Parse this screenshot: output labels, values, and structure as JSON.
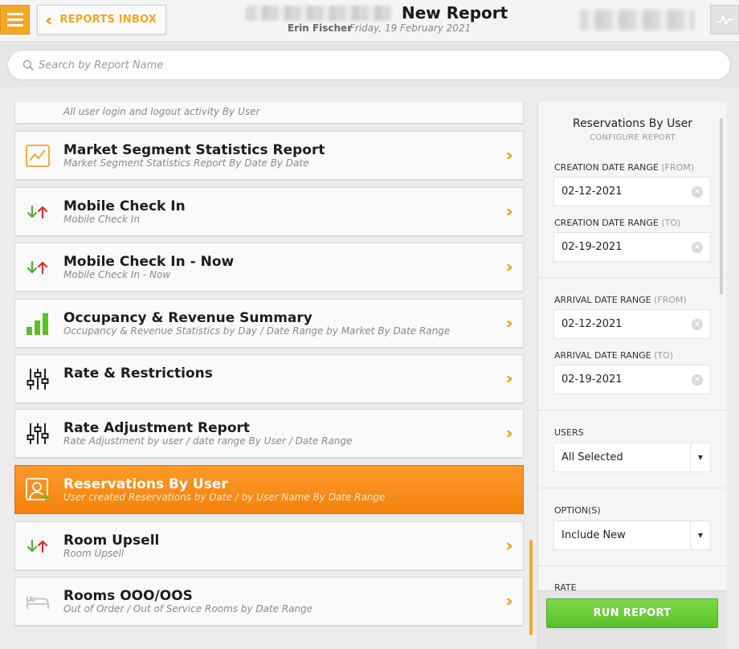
{
  "header": {
    "inbox_label": "REPORTS INBOX",
    "title": "New Report",
    "user": "Erin Fischer",
    "date": "Friday, 19 February 2021"
  },
  "search": {
    "placeholder": "Search by Report Name"
  },
  "reports": [
    {
      "title": "",
      "subtitle": "All user login and logout activity By User",
      "icon": "key-icon"
    },
    {
      "title": "Market Segment Statistics Report",
      "subtitle": "Market Segment Statistics Report By Date By Date",
      "icon": "line-chart-icon"
    },
    {
      "title": "Mobile Check In",
      "subtitle": "Mobile Check In",
      "icon": "arrows-up-down-icon"
    },
    {
      "title": "Mobile Check In - Now",
      "subtitle": "Mobile Check In - Now",
      "icon": "arrows-up-down-icon"
    },
    {
      "title": "Occupancy & Revenue Summary",
      "subtitle": "Occupancy & Revenue Statistics by Day / Date Range by Market By Date Range",
      "icon": "bar-chart-icon"
    },
    {
      "title": "Rate & Restrictions",
      "subtitle": "",
      "icon": "sliders-icon"
    },
    {
      "title": "Rate Adjustment Report",
      "subtitle": "Rate Adjustment by user / date range By User / Date Range",
      "icon": "sliders-icon"
    },
    {
      "title": "Reservations By User",
      "subtitle": "User created Reservations by Date / by User Name By Date Range",
      "icon": "user-export-icon",
      "selected": true
    },
    {
      "title": "Room Upsell",
      "subtitle": "Room Upsell",
      "icon": "arrows-up-down-icon"
    },
    {
      "title": "Rooms OOO/OOS",
      "subtitle": "Out of Order / Out of Service Rooms by Date Range",
      "icon": "bed-icon"
    }
  ],
  "config": {
    "title": "Reservations By User",
    "subtitle": "CONFIGURE REPORT",
    "creation_from_label": "CREATION DATE RANGE",
    "creation_from_paren": "(FROM)",
    "creation_from_value": "02-12-2021",
    "creation_to_label": "CREATION DATE RANGE",
    "creation_to_paren": "(TO)",
    "creation_to_value": "02-19-2021",
    "arrival_from_label": "ARRIVAL DATE RANGE",
    "arrival_from_paren": "(FROM)",
    "arrival_from_value": "02-12-2021",
    "arrival_to_label": "ARRIVAL DATE RANGE",
    "arrival_to_paren": "(TO)",
    "arrival_to_value": "02-19-2021",
    "users_label": "USERS",
    "users_value": "All Selected",
    "options_label": "OPTION(S)",
    "options_value": "Include New",
    "rate_label": "RATE",
    "run_label": "RUN REPORT"
  },
  "colors": {
    "accent": "#f5a623",
    "selected": "#f78c18",
    "run": "#66c832"
  }
}
